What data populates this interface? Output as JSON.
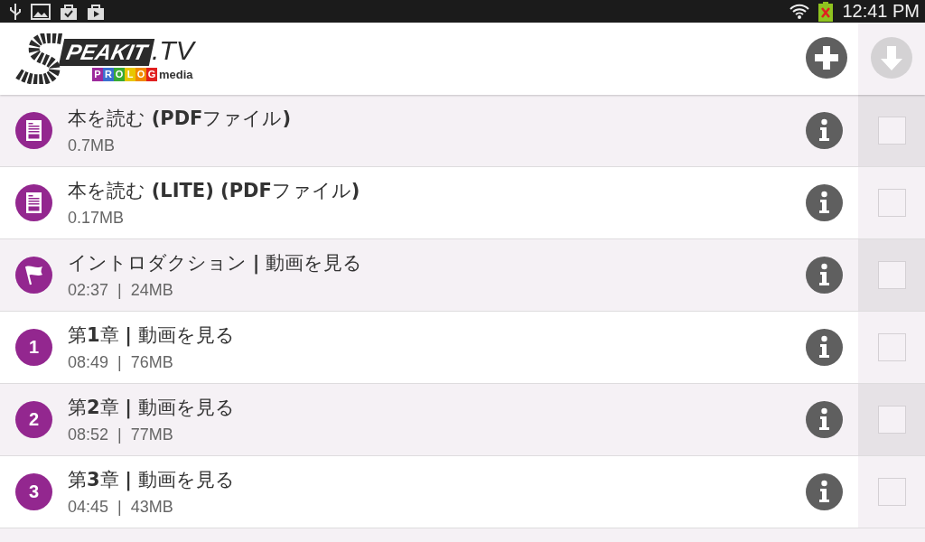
{
  "status_bar": {
    "time": "12:41 PM"
  },
  "header": {
    "logo": {
      "word": "PEAKIT",
      ".tv": ".TV",
      "letters": [
        {
          "char": "P",
          "color": "#9c2a9c"
        },
        {
          "char": "R",
          "color": "#3a6fd0"
        },
        {
          "char": "O",
          "color": "#3aaa35"
        },
        {
          "char": "L",
          "color": "#e8c600"
        },
        {
          "char": "O",
          "color": "#f08a00"
        },
        {
          "char": "G",
          "color": "#e02020"
        }
      ],
      "suffix": "media"
    },
    "download_disabled": true
  },
  "items": [
    {
      "kind": "pdf",
      "title": "本を読む **(PDF**ファイル**)**",
      "meta": "0.7MB",
      "checked": false
    },
    {
      "kind": "pdf",
      "title": "本を読む **(LITE) (PDF**ファイル**)**",
      "meta": "0.17MB",
      "checked": false
    },
    {
      "kind": "flag",
      "title": "イントロダクション **|** 動画を見る",
      "meta": "02:37  |  24MB",
      "checked": false
    },
    {
      "kind": "number",
      "number": "1",
      "title": "第**1**章 **|** 動画を見る",
      "meta": "08:49  |  76MB",
      "checked": false
    },
    {
      "kind": "number",
      "number": "2",
      "title": "第**2**章 **|** 動画を見る",
      "meta": "08:52  |  77MB",
      "checked": false
    },
    {
      "kind": "number",
      "number": "3",
      "title": "第**3**章 **|** 動画を見る",
      "meta": "04:45  |  43MB",
      "checked": false
    }
  ]
}
